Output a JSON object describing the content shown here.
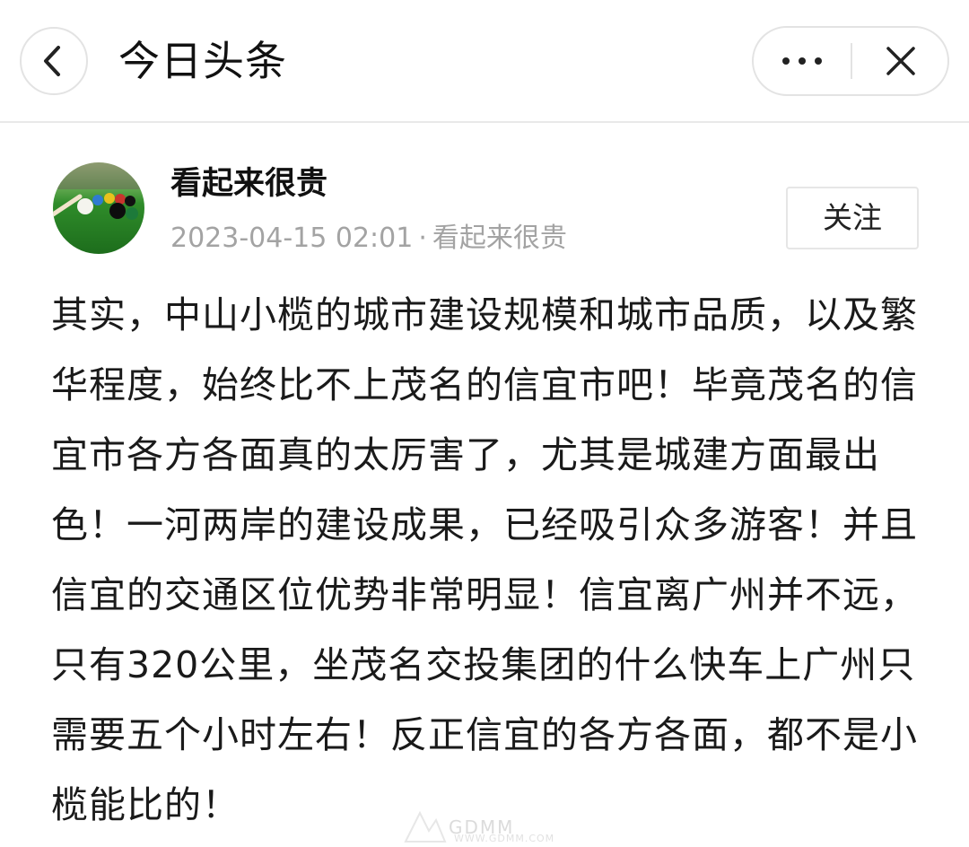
{
  "header": {
    "title": "今日头条",
    "back_icon": "chevron-left-icon",
    "more_icon": "more-dots-icon",
    "close_icon": "close-icon"
  },
  "post": {
    "author": "看起来很贵",
    "timestamp": "2023-04-15 02:01",
    "separator": "·",
    "source": "看起来很贵",
    "follow_label": "关注",
    "body": "其实，中山小榄的城市建设规模和城市品质，以及繁华程度，始终比不上茂名的信宜市吧！毕竟茂名的信宜市各方各面真的太厉害了，尤其是城建方面最出色！一河两岸的建设成果，已经吸引众多游客！并且信宜的交通区位优势非常明显！信宜离广州并不远，只有320公里，坐茂名交投集团的什么快车上广州只需要五个小时左右！反正信宜的各方各面，都不是小榄能比的！"
  },
  "watermark": {
    "text": "GDMM",
    "url": "WWW.GDMM.COM"
  }
}
